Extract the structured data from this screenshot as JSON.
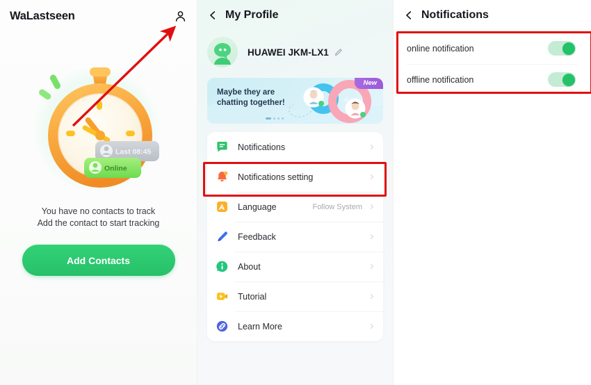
{
  "app": {
    "name": "WaLastseen",
    "profile_icon": "person-icon"
  },
  "home": {
    "illustration": {
      "name": "stopwatch-illustration",
      "badge_last_seen": "Last 08:45",
      "badge_online": "Online"
    },
    "empty_state_line1": "You have no contacts to track",
    "empty_state_line2": "Add the contact to start tracking",
    "add_contacts_label": "Add Contacts",
    "annotation": {
      "type": "red-arrow",
      "points_to": "profile-icon",
      "color": "#e00f0f"
    }
  },
  "profile": {
    "back_icon": "chevron-left-icon",
    "title": "My Profile",
    "avatar_icon": "robot-avatar-icon",
    "device_name": "HUAWEI JKM-LX1",
    "edit_icon": "pencil-edit-icon",
    "promo": {
      "text_line1": "Maybe they are",
      "text_line2": "chatting together!",
      "badge": "New",
      "dots": 4,
      "active_dot": 0
    },
    "menu": [
      {
        "label": "Notifications",
        "icon": "message-notification-icon",
        "detail": "",
        "chevron": "chevron-right-icon",
        "highlighted": false
      },
      {
        "label": "Notifications setting",
        "icon": "bell-settings-icon",
        "detail": "",
        "chevron": "chevron-right-icon",
        "highlighted": true
      },
      {
        "label": "Language",
        "icon": "language-letter-icon",
        "detail": "Follow System",
        "chevron": "chevron-right-icon",
        "highlighted": false
      },
      {
        "label": "Feedback",
        "icon": "pen-feedback-icon",
        "detail": "",
        "chevron": "chevron-right-icon",
        "highlighted": false
      },
      {
        "label": "About",
        "icon": "info-circle-icon",
        "detail": "",
        "chevron": "chevron-right-icon",
        "highlighted": false
      },
      {
        "label": "Tutorial",
        "icon": "video-play-icon",
        "detail": "",
        "chevron": "chevron-right-icon",
        "highlighted": false
      },
      {
        "label": "Learn More",
        "icon": "link-chain-icon",
        "detail": "",
        "chevron": "chevron-right-icon",
        "highlighted": false
      }
    ]
  },
  "notifications": {
    "back_icon": "chevron-left-icon",
    "title": "Notifications",
    "rows": [
      {
        "label": "online notification",
        "toggle_state": "on"
      },
      {
        "label": "offline notification",
        "toggle_state": "on"
      }
    ],
    "highlight_color": "#e00f0f"
  },
  "colors": {
    "accent_green": "#2ecc71",
    "toggle_on": "#23c268",
    "toggle_track": "#c4ecd5",
    "highlight_red": "#e00f0f",
    "promo_badge_purple": "#9a5bd8",
    "text_primary": "#16161d"
  }
}
